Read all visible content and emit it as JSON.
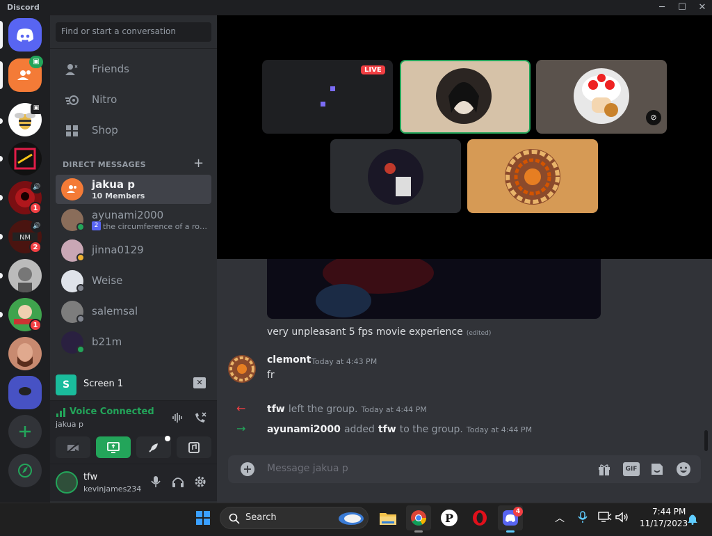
{
  "app": {
    "title": "Discord"
  },
  "servers": [
    {
      "name": "home"
    },
    {
      "name": "jakua p group"
    },
    {
      "name": "bee server"
    },
    {
      "name": "red square server"
    },
    {
      "name": "red server",
      "badge": "1"
    },
    {
      "name": "NM server",
      "badge": "2"
    },
    {
      "name": "man server"
    },
    {
      "name": "green server",
      "badge": "1"
    },
    {
      "name": "beard server"
    },
    {
      "name": "blue server"
    }
  ],
  "dm": {
    "search_placeholder": "Find or start a conversation",
    "nav": {
      "friends": "Friends",
      "nitro": "Nitro",
      "shop": "Shop"
    },
    "header": "DIRECT MESSAGES",
    "items": [
      {
        "name": "jakua p",
        "sub": "10 Members"
      },
      {
        "name": "ayunami2000",
        "sub": "the circumference of a roll...",
        "sub_badge": "2"
      },
      {
        "name": "jinna0129"
      },
      {
        "name": "Weise"
      },
      {
        "name": "salemsal"
      },
      {
        "name": "b21m"
      }
    ]
  },
  "voice": {
    "screen_label": "Screen 1",
    "status": "Voice Connected",
    "channel": "jakua p"
  },
  "user": {
    "name": "tfw",
    "tag": "kevinjames234"
  },
  "stage": {
    "live_label": "LIVE"
  },
  "messages": {
    "caption": "very unpleasant 5 fps movie experience",
    "edited": "(edited)",
    "author": "clemont",
    "author_time": "Today at 4:43 PM",
    "text": "fr",
    "sys1_actor": "tfw",
    "sys1_text": "left the group.",
    "sys1_time": "Today at 4:44 PM",
    "sys2_actor": "ayunami2000",
    "sys2_mid": "added",
    "sys2_target": "tfw",
    "sys2_text": "to the group.",
    "sys2_time": "Today at 4:44 PM"
  },
  "composer": {
    "placeholder": "Message jakua p",
    "gif": "GIF"
  },
  "taskbar": {
    "search": "Search",
    "time": "7:44 PM",
    "date": "11/17/2023",
    "discord_badge": "4"
  },
  "colors": {
    "accent": "#5865f2",
    "green": "#23a55a",
    "red": "#f23f43",
    "bg": "#313338"
  }
}
